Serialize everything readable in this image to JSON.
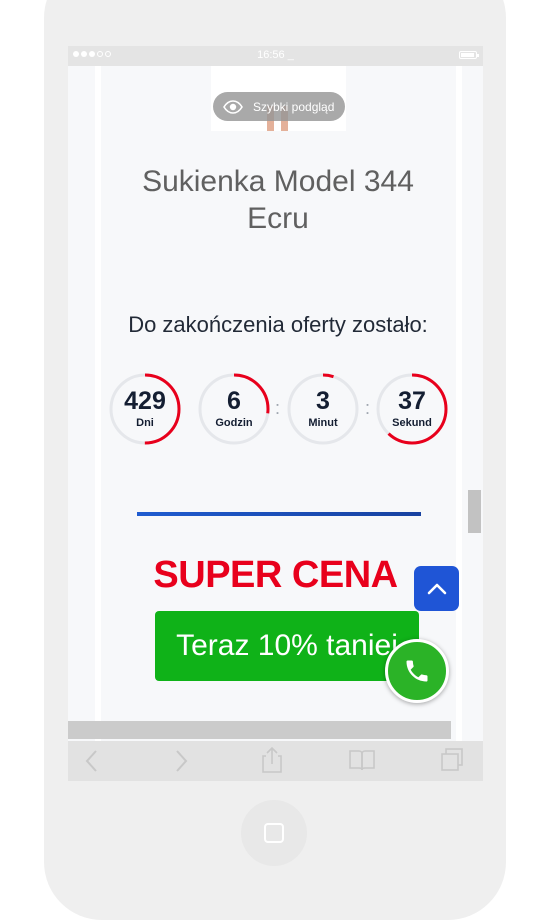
{
  "status_bar": {
    "time": "16:56 _"
  },
  "quick_view": {
    "label": "Szybki podgląd"
  },
  "product": {
    "title_line1": "Sukienka Model 344",
    "title_line2": "Ecru"
  },
  "offer": {
    "text": "Do zakończenia oferty zostało:"
  },
  "countdown": [
    {
      "value": "429",
      "unit": "Dni",
      "progress": 0.5
    },
    {
      "value": "6",
      "unit": "Godzin",
      "progress": 0.27
    },
    {
      "value": "3",
      "unit": "Minut",
      "progress": 0.05
    },
    {
      "value": "37",
      "unit": "Sekund",
      "progress": 0.62
    }
  ],
  "separators": [
    ":",
    ":"
  ],
  "promo": {
    "headline": "SUPER CENA",
    "button": "Teraz 10% taniej"
  },
  "colors": {
    "accent": "#e8001c",
    "cta": "#0fb218",
    "primary": "#1f55d6",
    "timer_ring": "#e5e7eb",
    "timer_progress": "#e8001c"
  },
  "icons": {
    "quick_view": "eye-icon",
    "scroll_top": "chevron-up-icon",
    "call": "phone-icon",
    "back": "chevron-left-icon",
    "forward": "chevron-right-icon",
    "share": "share-icon",
    "bookmarks": "book-icon",
    "tabs": "tabs-icon"
  }
}
